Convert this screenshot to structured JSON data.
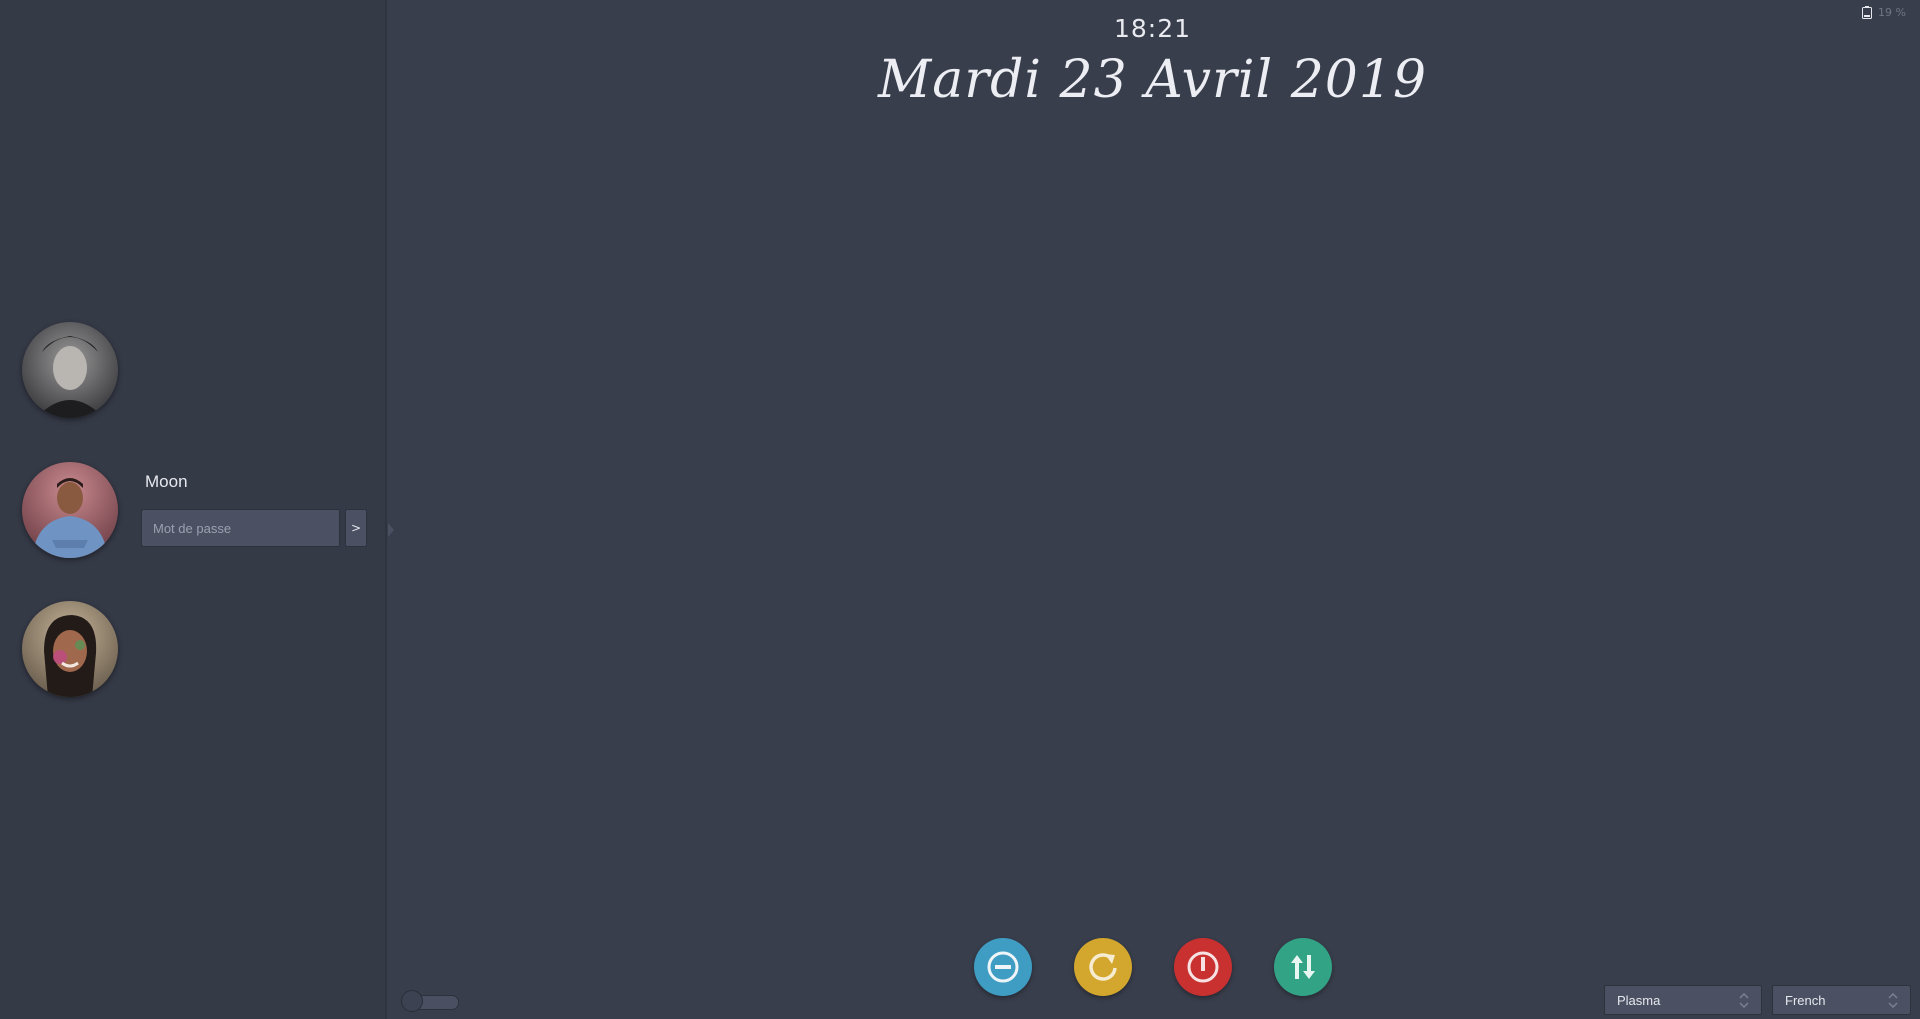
{
  "clock": {
    "time": "18:21",
    "date": "Mardi 23 Avril 2019"
  },
  "status": {
    "battery_percent": "19 %"
  },
  "users": [
    {
      "name": "",
      "avatar": "user-1-photo"
    },
    {
      "name": "Moon",
      "avatar": "user-2-photo",
      "selected": true
    },
    {
      "name": "",
      "avatar": "user-3-photo"
    }
  ],
  "login": {
    "username": "Moon",
    "password_placeholder": "Mot de passe",
    "submit_label": ">"
  },
  "actions": [
    {
      "name": "suspend",
      "icon": "minus-circle-icon",
      "color": "#3f9dc3"
    },
    {
      "name": "restart",
      "icon": "restart-icon",
      "color": "#d3a72d"
    },
    {
      "name": "shutdown",
      "icon": "power-icon",
      "color": "#c93131"
    },
    {
      "name": "switch-user",
      "icon": "swap-icon",
      "color": "#33a386"
    }
  ],
  "session": {
    "selected": "Plasma"
  },
  "keyboard": {
    "selected": "French"
  },
  "colors": {
    "background": "#393e4c",
    "sidebar": "#353a47"
  }
}
